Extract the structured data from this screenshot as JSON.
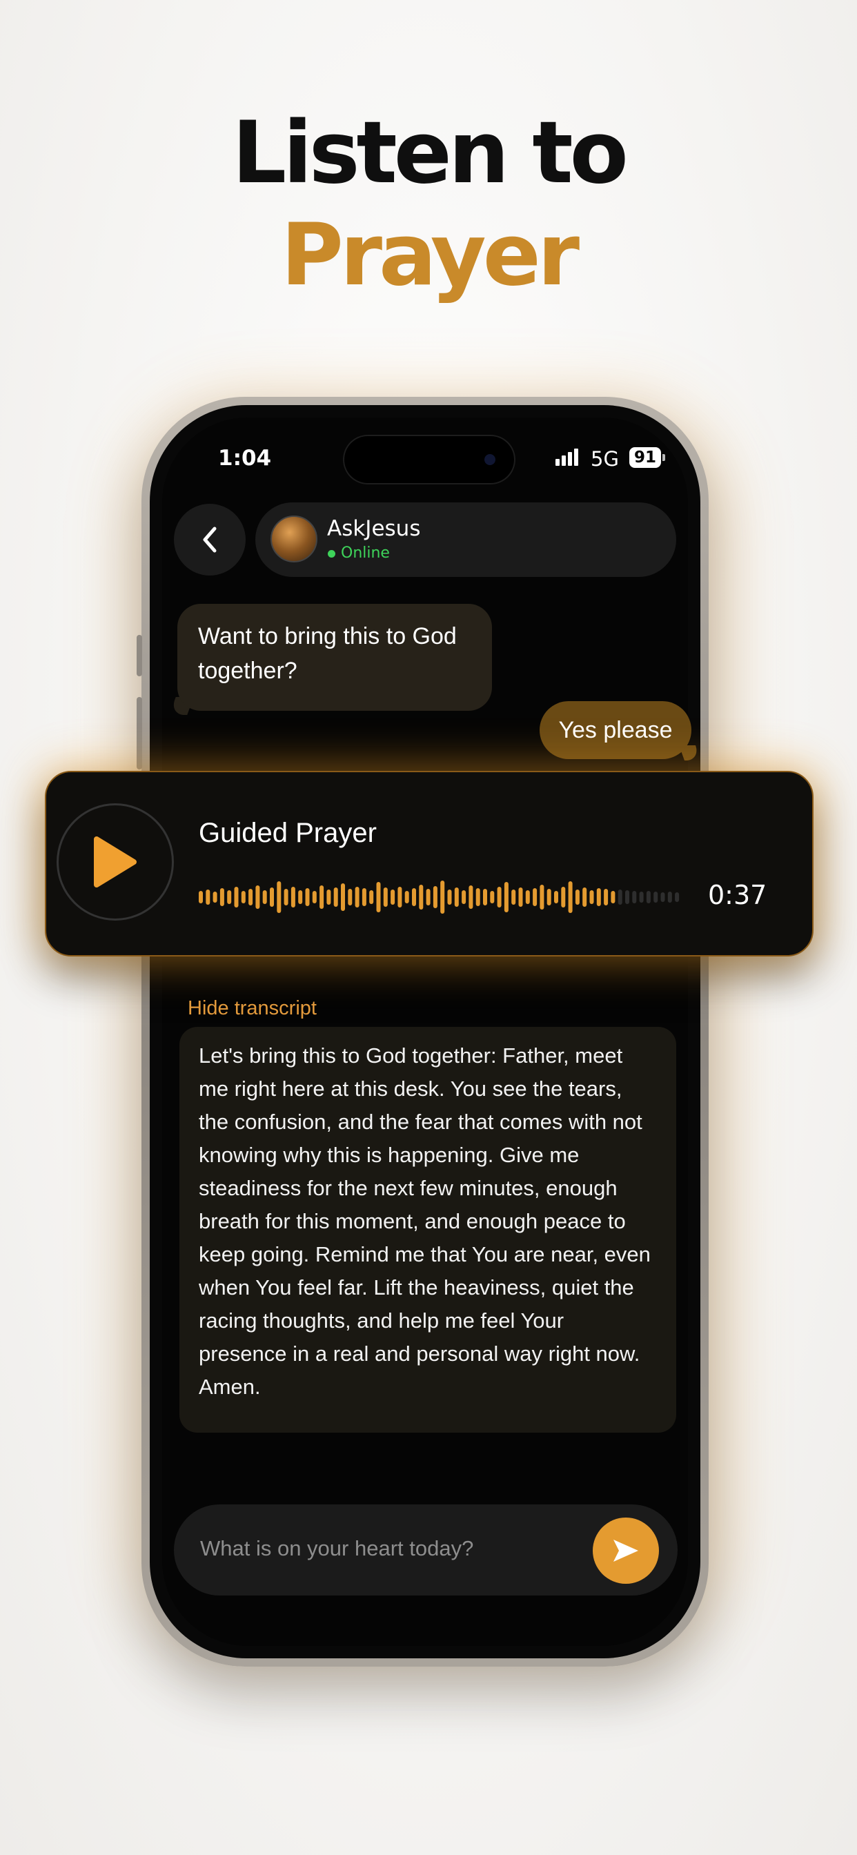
{
  "headline": {
    "line1": "Listen to",
    "line2": "Prayer"
  },
  "status_bar": {
    "time": "1:04",
    "network": "5G",
    "battery": "91"
  },
  "chat_header": {
    "back_icon": "chevron-left-icon",
    "contact_name": "AskJesus",
    "status": "Online"
  },
  "messages": [
    {
      "from": "bot",
      "text": "Want to bring this to God together?"
    },
    {
      "from": "user",
      "text": "Yes please"
    }
  ],
  "audio_player": {
    "title": "Guided Prayer",
    "duration": "0:37",
    "progress": 0.86,
    "play_icon": "play-icon"
  },
  "transcript": {
    "toggle_label": "Hide transcript",
    "text": "Let's bring this to God together: Father, meet me right here at this desk. You see the tears, the confusion, and the fear that comes with not knowing why this is happening. Give me steadiness for the next few minutes, enough breath for this moment, and enough peace to keep going. Remind me that You are near, even when You feel far. Lift the heaviness, quiet the racing thoughts, and help me feel Your presence in a real and personal way right now. Amen."
  },
  "composer": {
    "placeholder": "What is on your heart today?",
    "send_icon": "send-icon"
  },
  "colors": {
    "accent": "#e49b30",
    "headline_accent": "#c98a2a",
    "online": "#3ed35a"
  }
}
